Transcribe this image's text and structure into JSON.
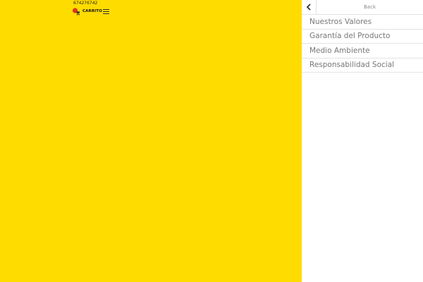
{
  "colors": {
    "background": "#FFDC00",
    "panel": "#FFFFFF",
    "divider": "#E3E3E3",
    "menu_text": "#777777"
  },
  "header": {
    "phone": "674276742",
    "cart_label": "CARRITO",
    "cart_icon": "cart-icon",
    "menu_icon": "hamburger-icon"
  },
  "side_menu": {
    "back_icon": "chevron-left-icon",
    "back_label": "Back",
    "items": [
      {
        "label": "Nuestros Valores"
      },
      {
        "label": "Garantía del Producto"
      },
      {
        "label": "Medio Ambiente"
      },
      {
        "label": "Responsabilidad Social"
      }
    ]
  }
}
